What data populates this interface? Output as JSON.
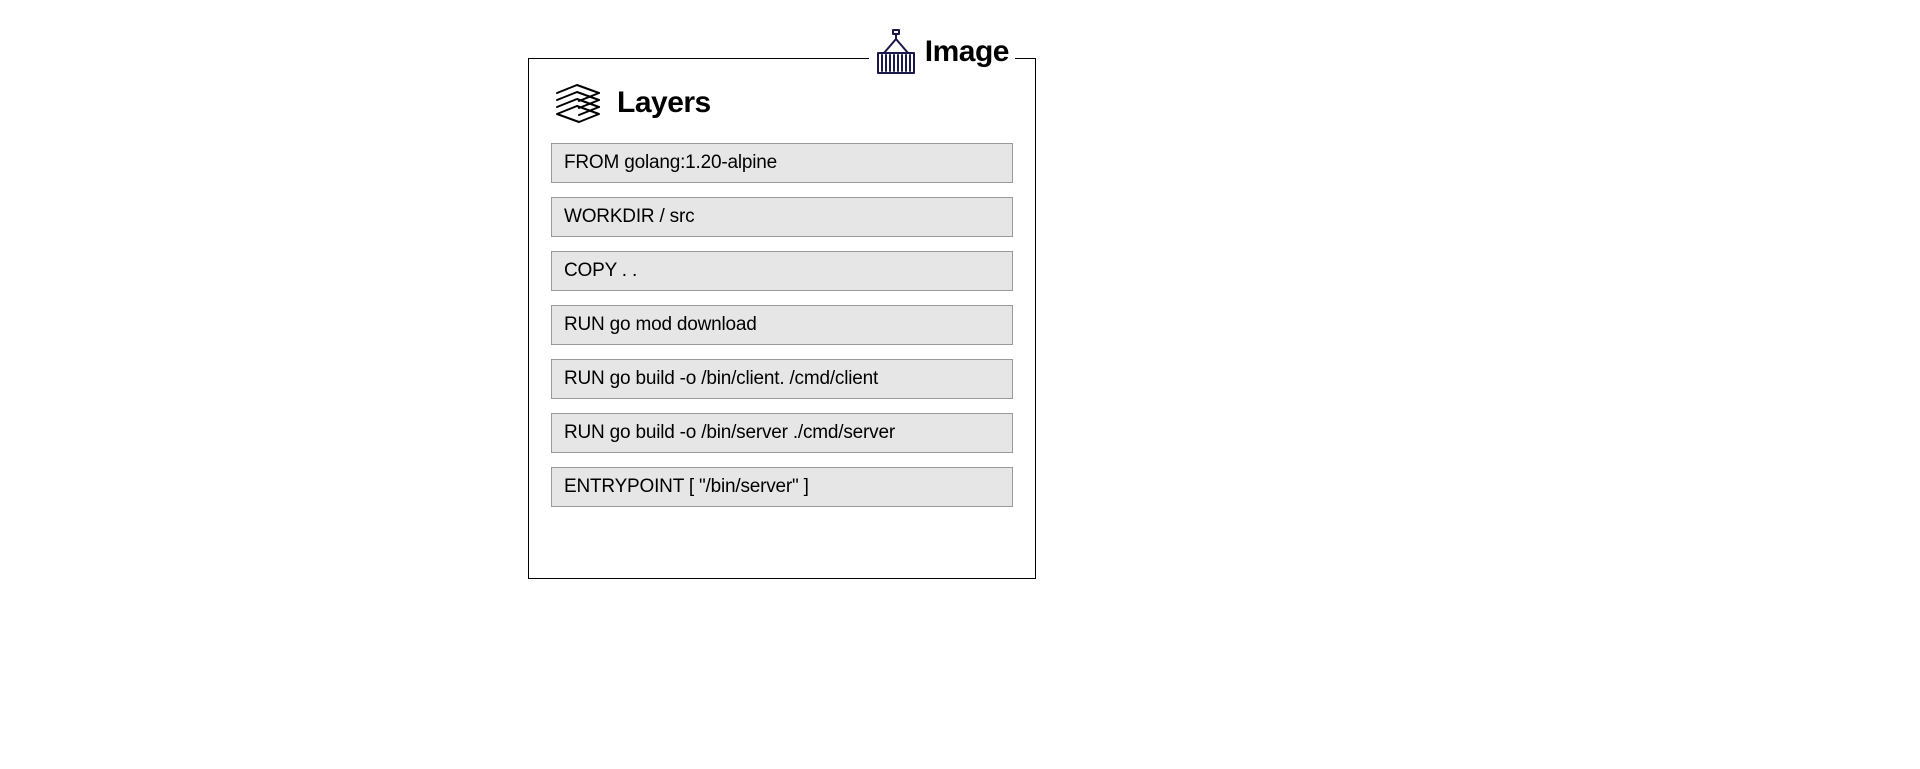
{
  "image": {
    "label": "Image"
  },
  "layers": {
    "title": "Layers",
    "items": [
      "FROM golang:1.20-alpine",
      "WORKDIR / src",
      "COPY . .",
      "RUN go mod download",
      "RUN go build -o /bin/client. /cmd/client",
      "RUN go build -o /bin/server ./cmd/server",
      "ENTRYPOINT [ \"/bin/server\" ]"
    ]
  },
  "colors": {
    "layer_bg": "#e6e6e6",
    "layer_border": "#9a9a9a",
    "container_outline": "#1a1a4a"
  }
}
